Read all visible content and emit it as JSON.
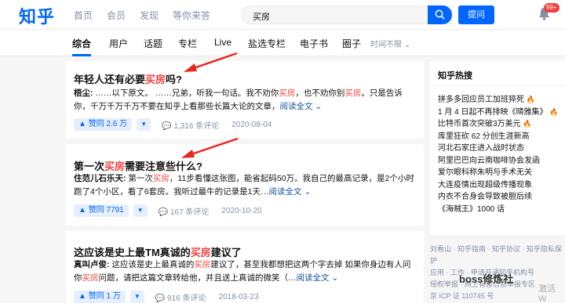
{
  "header": {
    "logo": "知乎",
    "nav": [
      "首页",
      "会员",
      "发现",
      "等你来答"
    ],
    "search_value": "买房",
    "ask_label": "提问",
    "notification_badge": "99+"
  },
  "tabs": {
    "items": [
      "综合",
      "用户",
      "话题",
      "专栏",
      "Live",
      "盐选专栏",
      "电子书",
      "圈子"
    ],
    "time_filter": "时间不限"
  },
  "results": [
    {
      "title_pre": "年轻人还有必要",
      "title_hl": "买房",
      "title_post": "吗?",
      "author": "梧尘:",
      "excerpt_a": " ……以下原文。 ……兄弟，听我一句话。我不劝你",
      "excerpt_hl1": "买房",
      "excerpt_b": "，也不劝你别",
      "excerpt_hl2": "买房",
      "excerpt_c": "。只是告诉你，千万千万千万不要在知乎上看那些长篇大论的文章，",
      "read_more": "阅读全文",
      "votes": "赞同 2.6 万",
      "comments": "1,316 条评论",
      "date": "2020-08-04"
    },
    {
      "title_pre": "第一次",
      "title_hl": "买房",
      "title_post": "需要注意些什么?",
      "author": "住范儿石乐天:",
      "excerpt_a": " 第一次",
      "excerpt_hl1": "买房",
      "excerpt_b": "，11步看懂这张图，能省起码50万。我自己的最高记录，是2个小时跑了4个小区，看了6套房。我听过最牛的记录是1天…",
      "excerpt_hl2": "",
      "excerpt_c": "",
      "read_more": "阅读全文",
      "votes": "赞同 7791",
      "comments": "167 条评论",
      "date": "2020-10-20"
    },
    {
      "title_pre": "这应该是史上最TM真诚的",
      "title_hl": "买房",
      "title_post": "建议了",
      "author": "真叫卢俊:",
      "excerpt_a": " 这应该是史上最真诚的",
      "excerpt_hl1": "买房",
      "excerpt_b": "建议了，甚至我都想把这两个字去掉 如果你身边有人问你",
      "excerpt_hl2": "买房",
      "excerpt_c": "问题，请把这篇文章转给他，并且送上真诚的微笑（…",
      "read_more": "阅读全文",
      "votes": "赞同 1 万",
      "comments": "916 条评论",
      "date": "2018-03-23"
    }
  ],
  "hot": {
    "title": "知乎热搜",
    "items": [
      {
        "text": "拼多多回应员工加班猝死",
        "fire": true
      },
      {
        "text": "1 月 4 日起不再排映《晴雅集》",
        "fire": true
      },
      {
        "text": "比特币首次突破3万美元",
        "fire": true
      },
      {
        "text": "库里狂砍 62 分创生涯新高",
        "fire": false
      },
      {
        "text": "河北石家庄进入战时状态",
        "fire": false
      },
      {
        "text": "阿里巴巴向云南咖啡协会发函",
        "fire": false
      },
      {
        "text": "爱尔眼科称朱明与手术无关",
        "fire": false
      },
      {
        "text": "大连疫情出现超级传播现象",
        "fire": false
      },
      {
        "text": "内衣不合身会导致被胆后续",
        "fire": false
      },
      {
        "text": "《海贼王》1000 话",
        "fire": false
      }
    ]
  },
  "footer": {
    "line1": "刘看山 · 知乎指南 · 知乎协议 · 知乎隐私保护",
    "line2": "应用 · 工作 · 申请开通知乎机构号",
    "line3": "侵权举报 · 网上有害信息举报专区",
    "line4": "京 ICP 证 110745 号"
  },
  "watermark": "boss修炼社",
  "watermark2": "激活 W"
}
